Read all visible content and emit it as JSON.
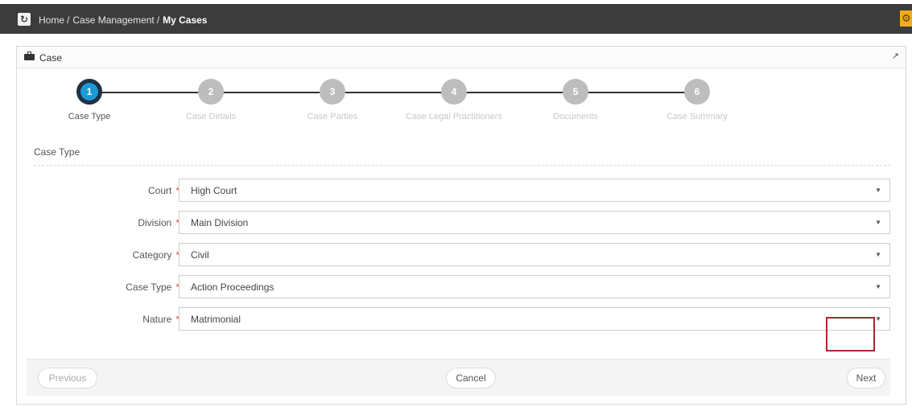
{
  "breadcrumb": {
    "items": [
      "Home",
      "Case Management"
    ],
    "separator": "/",
    "current": "My Cases"
  },
  "icons": {
    "refresh": "refresh-icon",
    "gear": "gear-icon",
    "briefcase": "briefcase-icon",
    "expand": "expand-icon",
    "caret": "caret-down-icon"
  },
  "panel": {
    "title": "Case"
  },
  "steps": [
    {
      "number": "1",
      "label": "Case Type",
      "active": true
    },
    {
      "number": "2",
      "label": "Case Details",
      "active": false
    },
    {
      "number": "3",
      "label": "Case Parties",
      "active": false
    },
    {
      "number": "4",
      "label": "Case Legal Practitioners",
      "active": false
    },
    {
      "number": "5",
      "label": "Documents",
      "active": false
    },
    {
      "number": "6",
      "label": "Case Summary",
      "active": false
    }
  ],
  "section": {
    "title": "Case Type"
  },
  "form": {
    "required_mark": "*",
    "fields": [
      {
        "label": "Court",
        "value": "High Court"
      },
      {
        "label": "Division",
        "value": "Main Division"
      },
      {
        "label": "Category",
        "value": "Civil"
      },
      {
        "label": "Case Type",
        "value": "Action Proceedings"
      },
      {
        "label": "Nature",
        "value": "Matrimonial"
      }
    ]
  },
  "buttons": {
    "previous": "Previous",
    "cancel": "Cancel",
    "next": "Next"
  },
  "colors": {
    "topbar": "#3c3c3c",
    "active_step": "#1a9ad6",
    "inactive_step": "#bdbdbd",
    "required": "#d9534f",
    "highlight": "#b3232b",
    "gear_button": "#f0ad1c"
  }
}
